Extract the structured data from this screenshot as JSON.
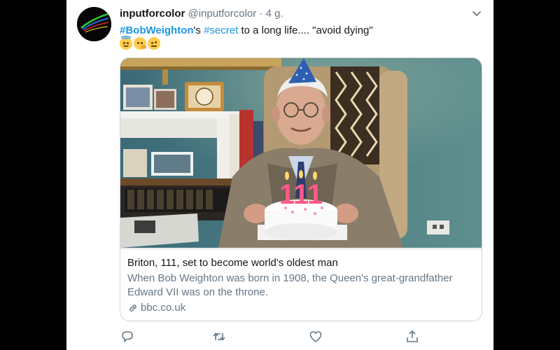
{
  "tweet": {
    "display_name": "inputforcolor",
    "handle": "@inputforcolor",
    "separator": "·",
    "timestamp": "4 g.",
    "text": {
      "hashtag1": "#BobWeighton",
      "suffix1": "'s ",
      "hashtag2": "#secret",
      "suffix2": " to a long life.... \"avoid dying\""
    },
    "emojis": [
      "smiling-face-with-halo-emoji",
      "thinking-face-emoji",
      "face-with-raised-eyebrow-emoji"
    ]
  },
  "link_card": {
    "title": "Briton, 111, set to become world's oldest man",
    "description": "When Bob Weighton was born in 1908, the Queen's great-grandfather Edward VII was on the throne.",
    "domain": "bbc.co.uk",
    "cake_number": "111"
  },
  "actions": [
    "reply-icon",
    "retweet-icon",
    "like-icon",
    "share-icon"
  ],
  "colors": {
    "link": "#1b95e0",
    "secondary_text": "#657786",
    "border": "#ccd6dd",
    "background": "#000000"
  }
}
